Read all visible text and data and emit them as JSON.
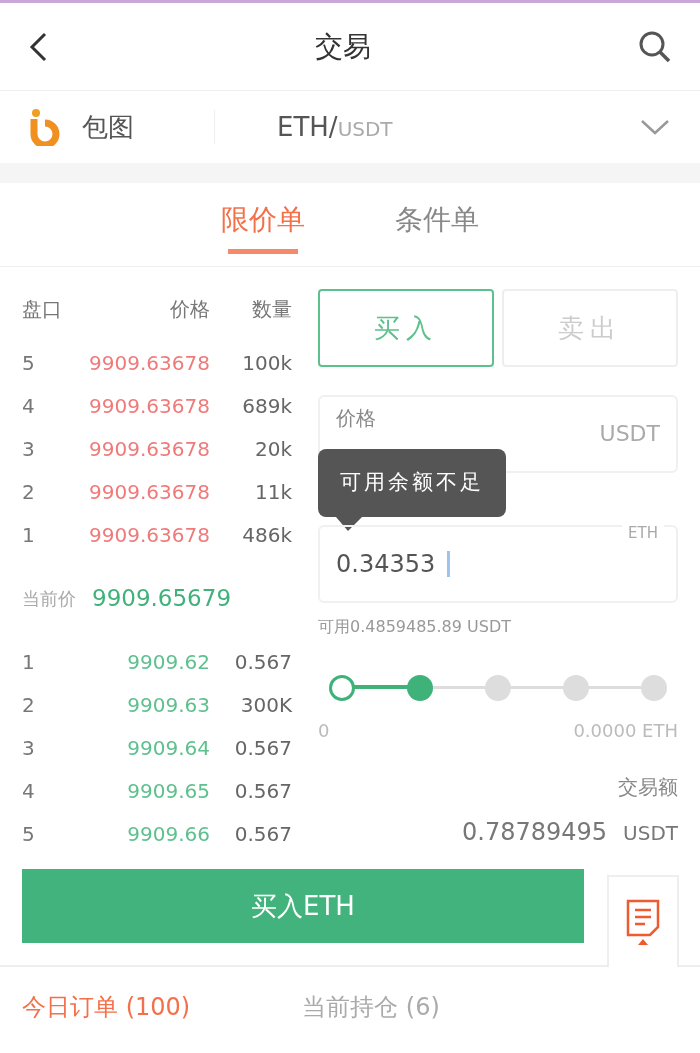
{
  "header": {
    "title": "交易"
  },
  "pair": {
    "brand": "包图",
    "base": "ETH/",
    "quote": "USDT"
  },
  "order_tabs": [
    {
      "label": "限价单",
      "selected": true
    },
    {
      "label": "条件单",
      "selected": false
    }
  ],
  "order_book": {
    "headers": [
      "盘口",
      "价格",
      "数量"
    ],
    "asks": [
      {
        "level": "5",
        "price": "9909.63678",
        "qty": "100k"
      },
      {
        "level": "4",
        "price": "9909.63678",
        "qty": "689k"
      },
      {
        "level": "3",
        "price": "9909.63678",
        "qty": "20k"
      },
      {
        "level": "2",
        "price": "9909.63678",
        "qty": "11k"
      },
      {
        "level": "1",
        "price": "9909.63678",
        "qty": "486k"
      }
    ],
    "current_price_label": "当前价",
    "current_price": "9909.65679",
    "bids": [
      {
        "level": "1",
        "price": "9909.62",
        "qty": "0.567"
      },
      {
        "level": "2",
        "price": "9909.63",
        "qty": "300K"
      },
      {
        "level": "3",
        "price": "9909.64",
        "qty": "0.567"
      },
      {
        "level": "4",
        "price": "9909.65",
        "qty": "0.567"
      },
      {
        "level": "5",
        "price": "9909.66",
        "qty": "0.567"
      }
    ]
  },
  "side_toggle": [
    {
      "label": "买入",
      "selected": true
    },
    {
      "label": "卖出",
      "selected": false
    }
  ],
  "price_field": {
    "label": "价格",
    "unit": "USDT"
  },
  "tooltip": "可用余额不足",
  "amount_field": {
    "value": "0.34353",
    "unit": "ETH"
  },
  "available": "可用0.4859485.89 USDT",
  "slider": {
    "level": 0.25,
    "min_label": "0",
    "max_label": "0.0000 ETH"
  },
  "total": {
    "label": "交易额",
    "value": "0.78789495",
    "unit": "USDT"
  },
  "submit_button": "买入ETH",
  "bottom_tabs": [
    {
      "label": "今日订单 (100)",
      "selected": true
    },
    {
      "label": "当前持仓 (6)",
      "selected": false
    }
  ]
}
